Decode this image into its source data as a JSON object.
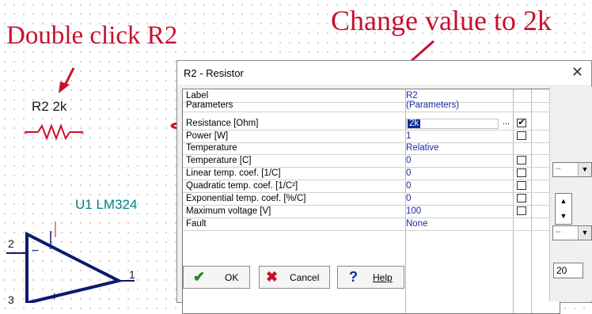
{
  "annotations": {
    "left": "Double click R2",
    "right": "Change value to 2k",
    "accent_color": "#c8102e"
  },
  "schematic": {
    "r2_label": "R2 2k",
    "u1_label": "U1 LM324",
    "pin_2": "2",
    "pin_1": "1",
    "pin_3": "3",
    "minus": "−",
    "plus": "+",
    "wire_color": "#0b1b6e",
    "resistor_color": "#c8102e"
  },
  "dialog": {
    "title": "R2 - Resistor",
    "close_icon": "close-icon",
    "rows": [
      {
        "name": "Label",
        "value": "R2",
        "check": ""
      },
      {
        "name": "Parameters",
        "value": "(Parameters)",
        "check": ""
      },
      {
        "name": "Resistance [Ohm]",
        "value": "2k",
        "check": "✔"
      },
      {
        "name": "Power       [W]",
        "value": "1",
        "check": ""
      },
      {
        "name": "Temperature",
        "value": "Relative",
        "check": ""
      },
      {
        "name": "Temperature [C]",
        "value": "0",
        "check": ""
      },
      {
        "name": "Linear temp. coef. [1/C]",
        "value": "0",
        "check": ""
      },
      {
        "name": "Quadratic temp. coef. [1/C²]",
        "value": "0",
        "check": ""
      },
      {
        "name": "Exponential temp. coef. [%/C]",
        "value": "0",
        "check": ""
      },
      {
        "name": "Maximum voltage [V]",
        "value": "100",
        "check": ""
      },
      {
        "name": "Fault",
        "value": "None",
        "check": ""
      }
    ],
    "edit_button": "...",
    "right_panel": {
      "combo1": "--",
      "combo2": "--",
      "number": "20"
    },
    "buttons": {
      "ok": "OK",
      "cancel": "Cancel",
      "help": "Help"
    }
  }
}
